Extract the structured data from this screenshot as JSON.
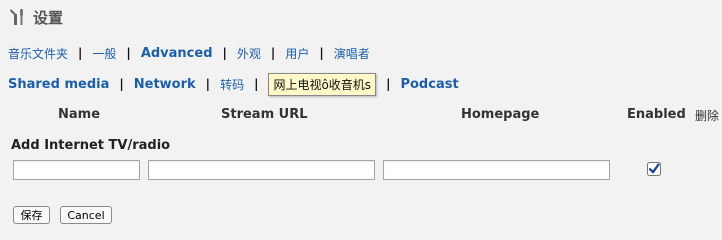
{
  "title": "设置",
  "nav_row1": [
    "音乐文件夹",
    "一般",
    "Advanced",
    "外观",
    "用户",
    "演唱者"
  ],
  "nav_row2": [
    "Shared media",
    "Network",
    "转码",
    "网上电视ô收音机s",
    "Podcast"
  ],
  "nav_row2_active_index": 3,
  "table_headers": {
    "name": "Name",
    "stream_url": "Stream URL",
    "homepage": "Homepage",
    "enabled": "Enabled",
    "delete": "删除"
  },
  "add_label": "Add Internet TV/radio",
  "inputs": {
    "name_value": "",
    "stream_url_value": "",
    "homepage_value": ""
  },
  "enabled_checked": true,
  "buttons": {
    "save": "保存",
    "cancel": "Cancel"
  },
  "colors": {
    "link": "#1d5fa6",
    "active_tab_bg": "#fff8c8",
    "page_bg": "#f2f2f2"
  }
}
